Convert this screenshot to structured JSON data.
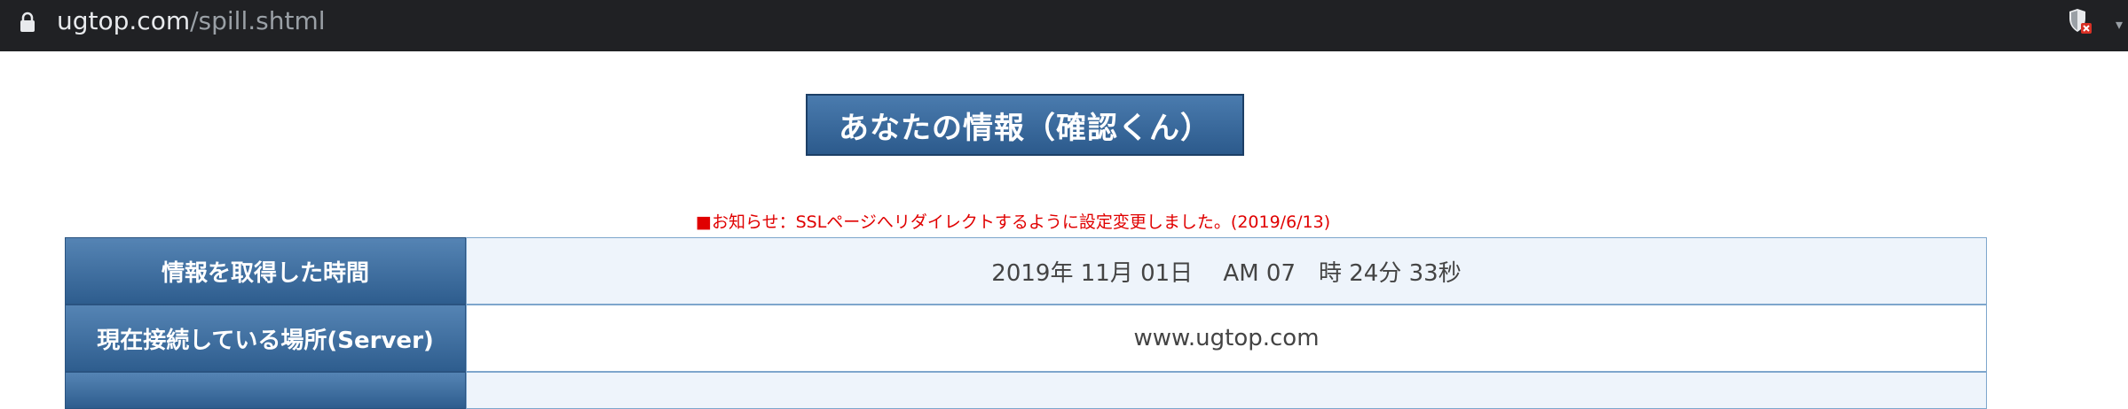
{
  "browser": {
    "url_host": "ugtop.com",
    "url_path": "/spill.shtml",
    "icons": [
      "lock-icon",
      "shield-blocked-icon",
      "chevron-down-icon"
    ]
  },
  "page": {
    "title": "あなたの情報（確認くん）",
    "notice": "■お知らせ：SSLページへリダイレクトするように設定変更しました。(2019/6/13)"
  },
  "table": {
    "rows": [
      {
        "label": "情報を取得した時間",
        "value": "2019年 11月 01日　 AM 07　時 24分 33秒"
      },
      {
        "label": "現在接続している場所(Server)",
        "value": "www.ugtop.com"
      }
    ]
  },
  "colors": {
    "browser_bar": "#202124",
    "header_blue": "#2e5d8e",
    "notice_red": "#e00000",
    "row_tint": "#eef4fb"
  }
}
